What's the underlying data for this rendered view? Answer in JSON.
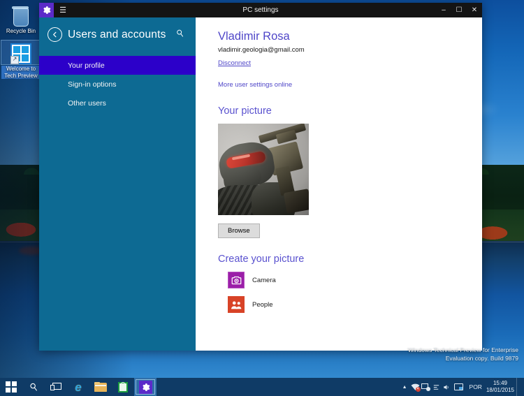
{
  "desktop": {
    "icons": [
      {
        "label": "Recycle Bin",
        "icon": "recycle-bin-icon",
        "selected": false
      },
      {
        "label": "Welcome to Tech Preview",
        "icon": "windows-logo-icon",
        "selected": true
      }
    ],
    "watermark": {
      "line1": "Windows Technical Preview for Enterprise",
      "line2": "Evaluation copy. Build 9879"
    }
  },
  "window": {
    "title": "PC settings",
    "titlebar_icons": {
      "app": "gear-icon",
      "menu": "hamburger-icon"
    },
    "controls": {
      "minimize": "–",
      "maximize": "☐",
      "close": "✕"
    }
  },
  "sidebar": {
    "back_icon": "back-arrow-icon",
    "title": "Users and accounts",
    "search_icon": "search-icon",
    "items": [
      {
        "label": "Your profile",
        "active": true
      },
      {
        "label": "Sign-in options",
        "active": false
      },
      {
        "label": "Other users",
        "active": false
      }
    ]
  },
  "main": {
    "account": {
      "name": "Vladimir Rosa",
      "email": "vladimir.geologia@gmail.com",
      "disconnect_link": "Disconnect",
      "more_settings_link": "More user settings online"
    },
    "your_picture": {
      "heading": "Your picture",
      "avatar_alt": "Crysis nanosuit soldier with red visor holding rifle",
      "browse_label": "Browse"
    },
    "create_picture": {
      "heading": "Create your picture",
      "tiles": [
        {
          "label": "Camera",
          "icon": "camera-icon",
          "color": "#9b1fa8"
        },
        {
          "label": "People",
          "icon": "people-icon",
          "color": "#d84327"
        }
      ]
    }
  },
  "taskbar": {
    "buttons": [
      {
        "name": "start-button",
        "icon": "windows-logo-icon",
        "active": false
      },
      {
        "name": "search-button",
        "icon": "search-icon",
        "active": false
      },
      {
        "name": "task-view-button",
        "icon": "task-view-icon",
        "active": false
      },
      {
        "name": "internet-explorer-button",
        "icon": "internet-explorer-icon",
        "active": false
      },
      {
        "name": "file-explorer-button",
        "icon": "folder-icon",
        "active": false
      },
      {
        "name": "store-button",
        "icon": "store-bag-icon",
        "active": false
      },
      {
        "name": "pc-settings-button",
        "icon": "gear-icon",
        "active": true
      }
    ],
    "tray": {
      "overflow": "▲",
      "icons": [
        "network-error-icon",
        "antivirus-icon",
        "action-icon",
        "volume-icon",
        "notification-icon"
      ],
      "language": "POR",
      "time": "15:49",
      "date": "18/01/2015"
    }
  },
  "colors": {
    "sidebar_bg": "#0d6a93",
    "sidebar_active": "#2c00c9",
    "accent_purple": "#4f46c8",
    "titlebar": "#141414",
    "taskbar": "#0f3b66"
  }
}
